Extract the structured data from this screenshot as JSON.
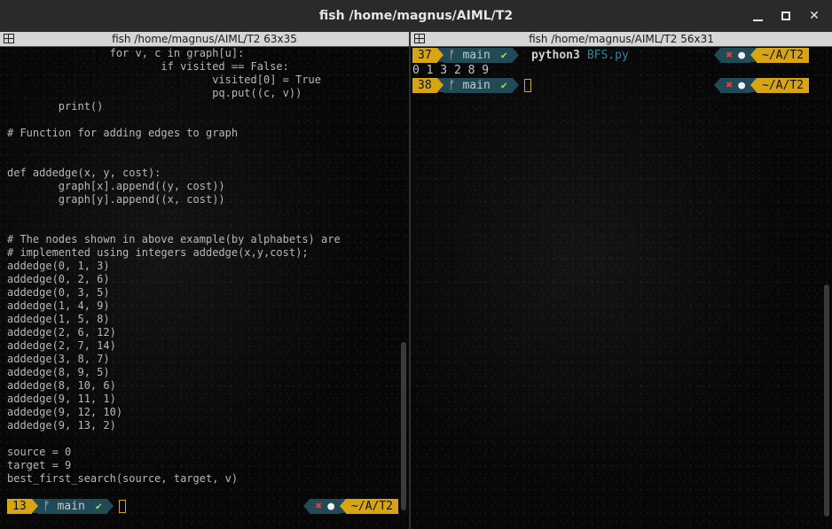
{
  "window": {
    "title": "fish  /home/magnus/AIML/T2"
  },
  "left_pane": {
    "tab_title": "fish  /home/magnus/AIML/T2 63x35",
    "code_lines": [
      "                for v, c in graph[u]:",
      "                        if visited == False:",
      "                                visited[0] = True",
      "                                pq.put((c, v))",
      "        print()",
      "",
      "# Function for adding edges to graph",
      "",
      "",
      "def addedge(x, y, cost):",
      "        graph[x].append((y, cost))",
      "        graph[y].append((x, cost))",
      "",
      "",
      "# The nodes shown in above example(by alphabets) are",
      "# implemented using integers addedge(x,y,cost);",
      "addedge(0, 1, 3)",
      "addedge(0, 2, 6)",
      "addedge(0, 3, 5)",
      "addedge(1, 4, 9)",
      "addedge(1, 5, 8)",
      "addedge(2, 6, 12)",
      "addedge(2, 7, 14)",
      "addedge(3, 8, 7)",
      "addedge(8, 9, 5)",
      "addedge(8, 10, 6)",
      "addedge(9, 11, 1)",
      "addedge(9, 12, 10)",
      "addedge(9, 13, 2)",
      "",
      "source = 0",
      "target = 9",
      "best_first_search(source, target, v)"
    ],
    "prompt": {
      "line_number": "13",
      "branch": "main",
      "check": "✔",
      "status_x": "✖",
      "status_dot": "●",
      "dir": "~/A/T2"
    }
  },
  "right_pane": {
    "tab_title": "fish  /home/magnus/AIML/T2 56x31",
    "prompt1": {
      "line_number": "37",
      "branch": "main",
      "check": "✔",
      "command": "python3",
      "argument": "BFS.py",
      "status_x": "✖",
      "status_dot": "●",
      "dir": "~/A/T2"
    },
    "output": "0 1 3 2 8 9",
    "prompt2": {
      "line_number": "38",
      "branch": "main",
      "check": "✔",
      "status_x": "✖",
      "status_dot": "●",
      "dir": "~/A/T2"
    }
  },
  "colors": {
    "accent_yellow": "#d7a414",
    "segment_teal": "#1f4a56",
    "check_green": "#9be35a",
    "error_red": "#e04040",
    "arg_cyan": "#2a8aa0"
  }
}
